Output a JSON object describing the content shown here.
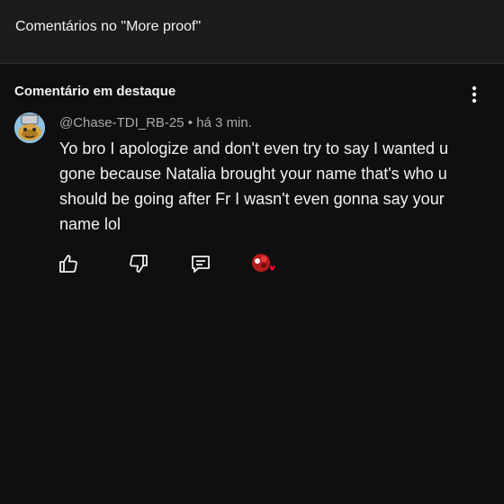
{
  "header": {
    "title": "Comentários no \"More proof\""
  },
  "pinned_section": {
    "title": "Comentário em destaque"
  },
  "comment": {
    "author": "@Chase-TDI_RB-25",
    "separator": " • ",
    "time": "há 3 min.",
    "text": "Yo bro I apologize and don't even try to say I wanted u gone because Natalia brought your name that's who u should be going after Fr I wasn't even gonna say your name lol"
  },
  "actions": {
    "like_icon": "thumbs-up-icon",
    "dislike_icon": "thumbs-down-icon",
    "reply_icon": "reply-icon",
    "creator_heart_icon": "creator-heart-icon"
  },
  "colors": {
    "background": "#0f0f0f",
    "header_background": "#1c1c1c",
    "text_primary": "#f1f1f1",
    "text_secondary": "#aaaaaa",
    "heart": "#ff0033"
  }
}
